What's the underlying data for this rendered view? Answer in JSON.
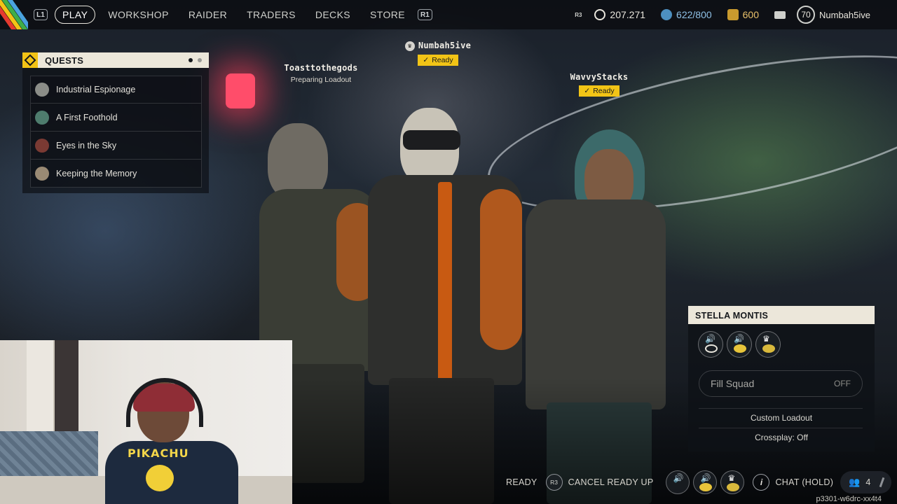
{
  "topbar": {
    "left_hint": "L1",
    "right_hint": "R1",
    "nav": [
      "PLAY",
      "WORKSHOP",
      "RAIDER",
      "TRADERS",
      "DECKS",
      "STORE"
    ],
    "active_nav": "PLAY",
    "stats": {
      "r3_hint": "R3",
      "raider_tokens": "207.271",
      "credits": "622/800",
      "coins": "600",
      "level": "70",
      "username": "Numbah5ive"
    }
  },
  "quests": {
    "title": "QUESTS",
    "items": [
      {
        "label": "Industrial Espionage"
      },
      {
        "label": "A First Foothold"
      },
      {
        "label": "Eyes in the Sky"
      },
      {
        "label": "Keeping the Memory"
      }
    ]
  },
  "squad": {
    "leader": {
      "name": "Numbah5ive",
      "status": "Ready"
    },
    "left": {
      "name": "Toasttothegods",
      "status": "Preparing Loadout"
    },
    "right": {
      "name": "WavvyStacks",
      "status": "Ready"
    }
  },
  "map_panel": {
    "title": "STELLA MONTIS",
    "fill_squad_label": "Fill Squad",
    "fill_squad_value": "OFF",
    "custom_loadout": "Custom Loadout",
    "crossplay": "Crossplay: Off"
  },
  "bottom_bar": {
    "ready": "READY",
    "cancel_hint": "R3",
    "cancel": "CANCEL READY UP",
    "chat": "CHAT (HOLD)",
    "party_count": "4"
  },
  "session_id": "p3301-w6drc-xx4t4",
  "webcam": {
    "shirt_text": "PIKACHU"
  },
  "colors": {
    "accent_yellow": "#f2c416",
    "header_cream": "#ece7da",
    "credits_blue": "#4d8fbf",
    "coins_gold": "#c99a2e"
  },
  "icons": [
    "raider-tokens-icon",
    "credits-icon",
    "coins-icon",
    "mail-icon",
    "crown-icon",
    "check-icon",
    "speaker-icon",
    "info-icon",
    "party-icon",
    "mic-icon"
  ]
}
